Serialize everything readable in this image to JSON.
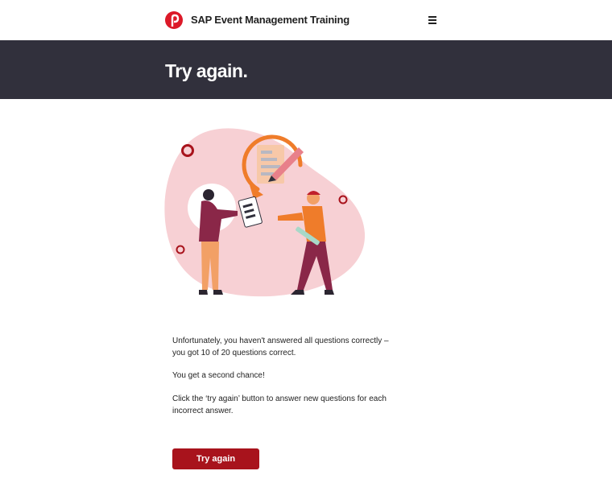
{
  "header": {
    "app_title": "SAP Event Management Training",
    "logo_icon": "post-logo-icon",
    "menu_icon": "hamburger-menu-icon"
  },
  "hero": {
    "title": "Try again."
  },
  "illustration": {
    "icon": "review-quiz-illustration"
  },
  "message": {
    "line1": "Unfortunately, you haven't answered all questions correctly – you got 10 of 20 questions correct.",
    "line2": "You get a second chance!",
    "line3": "Click the ‘try again’ button to answer new questions for each incorrect answer."
  },
  "actions": {
    "try_again_label": "Try again"
  },
  "colors": {
    "brand_red": "#a8131c",
    "hero_bg": "#31303c",
    "blob_pink": "#f7d0d4",
    "accent_orange": "#ef7c2a"
  }
}
